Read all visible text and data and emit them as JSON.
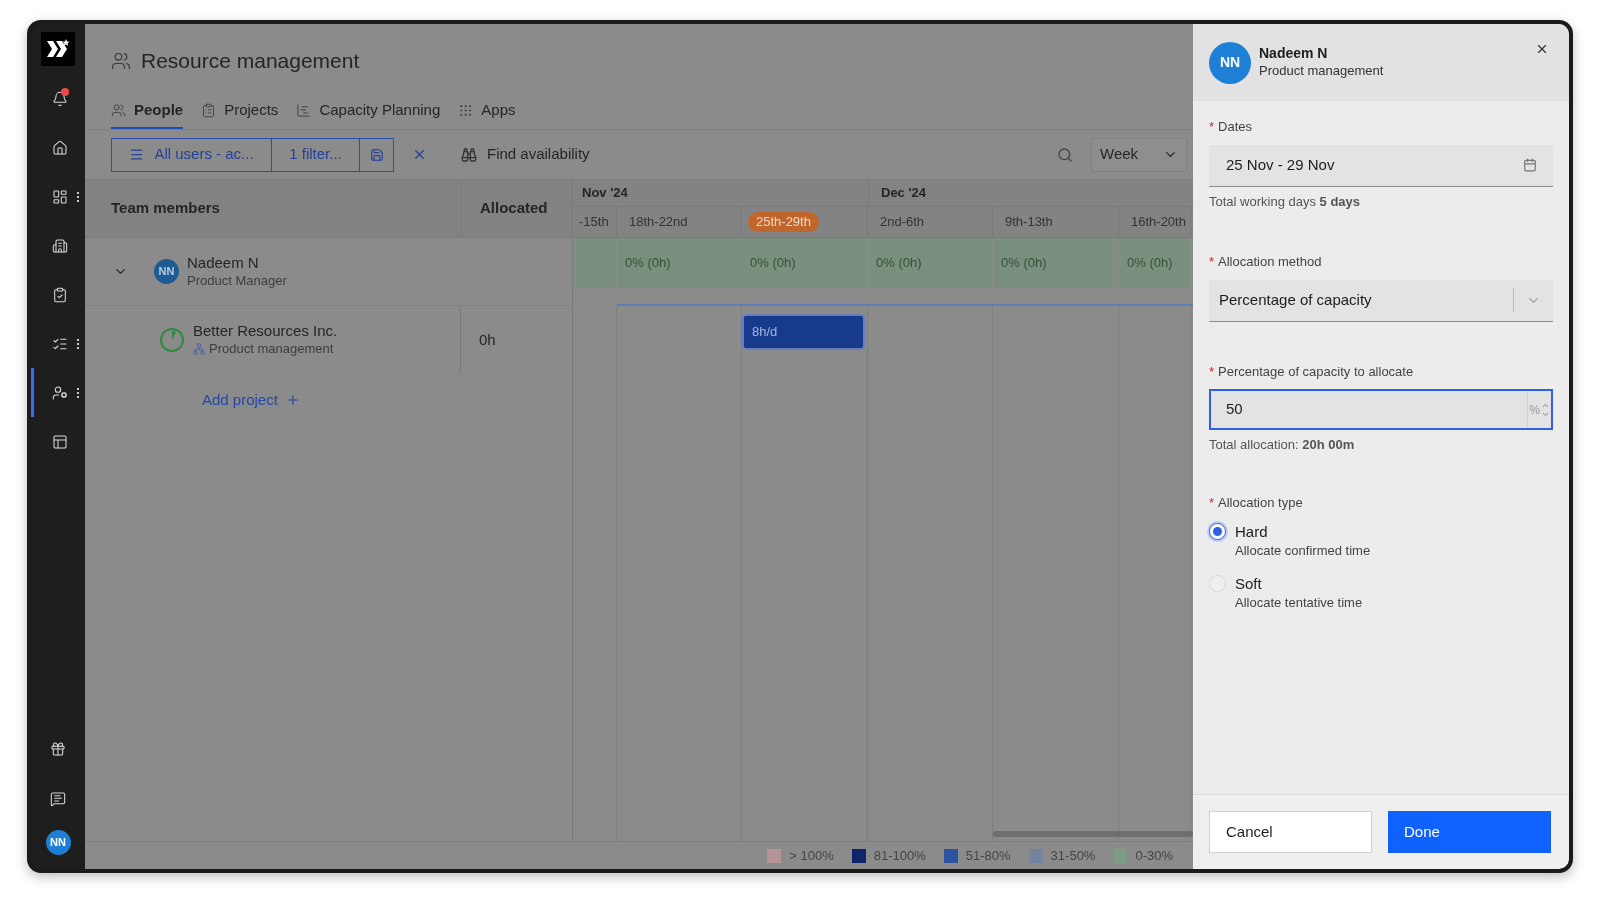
{
  "window": {
    "title": "Resource management"
  },
  "sidebar": {
    "items": [
      {
        "kind": "bell",
        "selected": false,
        "badge": true,
        "menu": false
      },
      {
        "kind": "home",
        "selected": false,
        "badge": false,
        "menu": false
      },
      {
        "kind": "dashboard",
        "selected": false,
        "badge": false,
        "menu": true
      },
      {
        "kind": "building",
        "selected": false,
        "badge": false,
        "menu": false
      },
      {
        "kind": "clipboard",
        "selected": false,
        "badge": false,
        "menu": false
      },
      {
        "kind": "checklist",
        "selected": false,
        "badge": false,
        "menu": true
      },
      {
        "kind": "people",
        "selected": true,
        "badge": false,
        "menu": true
      },
      {
        "kind": "layout",
        "selected": false,
        "badge": false,
        "menu": false
      }
    ],
    "bottom": [
      {
        "kind": "gift"
      },
      {
        "kind": "chat"
      }
    ],
    "avatar": "NN"
  },
  "tabs": [
    {
      "label": "People",
      "selected": true,
      "kind": "people"
    },
    {
      "label": "Projects",
      "selected": false,
      "kind": "projects"
    },
    {
      "label": "Capacity Planning",
      "selected": false,
      "kind": "capacity"
    },
    {
      "label": "Apps",
      "selected": false,
      "kind": "apps"
    }
  ],
  "toolbar": {
    "view_button": "All users - ac...",
    "filter_button": "1 filter...",
    "find": "Find availability",
    "period": "Week"
  },
  "table": {
    "columns": [
      "Team members",
      "Allocated"
    ],
    "months": [
      "Nov '24",
      "Dec '24"
    ],
    "weeks": [
      {
        "label": "-15th",
        "current": false
      },
      {
        "label": "18th-22nd",
        "current": false
      },
      {
        "label": "25th-29th",
        "current": true
      },
      {
        "label": "2nd-6th",
        "current": false
      },
      {
        "label": "9th-13th",
        "current": false
      },
      {
        "label": "16th-20th",
        "current": false
      }
    ],
    "person": {
      "initials": "NN",
      "name": "Nadeem N",
      "role": "Product Manager",
      "expanded": true,
      "cells": [
        "",
        "0% (0h)",
        "0% (0h)",
        "0% (0h)",
        "0% (0h)",
        "0% (0h)"
      ]
    },
    "project": {
      "name": "Better Resources Inc.",
      "team": "Product management",
      "allocated": "0h",
      "block": "8h/d"
    },
    "add_project": "Add project"
  },
  "legend": [
    {
      "label": "> 100%",
      "color": "#b79597"
    },
    {
      "label": "81-100%",
      "color": "#10266a"
    },
    {
      "label": "51-80%",
      "color": "#2c53a0"
    },
    {
      "label": "31-50%",
      "color": "#75849e"
    },
    {
      "label": "0-30%",
      "color": "#7d9a82"
    }
  ],
  "panel": {
    "initials": "NN",
    "name": "Nadeem N",
    "team": "Product management",
    "dates": {
      "mark": "*",
      "label": "Dates",
      "value": "25 Nov - 29 Nov",
      "hint": "Total working days **5 days**"
    },
    "method": {
      "mark": "*",
      "label": "Allocation method",
      "value": "Percentage of capacity"
    },
    "percent": {
      "mark": "*",
      "label": "Percentage of capacity to allocate",
      "value": "50",
      "unit": "%",
      "hint": "Total allocation: **20h 00m**"
    },
    "type": {
      "mark": "*",
      "label": "Allocation type",
      "options": [
        {
          "label": "Hard",
          "description": "Allocate confirmed time",
          "selected": true
        },
        {
          "label": "Soft",
          "description": "Allocate tentative time",
          "selected": false
        }
      ]
    },
    "buttons": [
      "Cancel",
      "Done"
    ]
  }
}
